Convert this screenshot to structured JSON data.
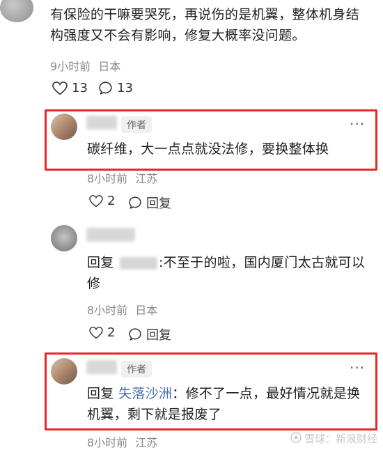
{
  "top_comment": {
    "text": "有保险的干嘛要哭死，再说伤的是机翼，整体机身结构强度又不会有影响，修复大概率没问题。",
    "time": "9小时前",
    "location": "日本",
    "likes": "13",
    "replies": "13"
  },
  "reply1": {
    "badge": "作者",
    "more": "···",
    "text": "碳纤维，大一点点就没法修，要换整体换",
    "time": "8小时前",
    "location": "江苏",
    "likes": "2",
    "reply_label": "回复"
  },
  "reply2": {
    "name_visible": "ㄓ",
    "prefix": "回复",
    "rest": ":不至于的啦，国内厦门太古就可以修",
    "time": "8小时前",
    "location": "日本",
    "likes": "2",
    "reply_label": "回复"
  },
  "reply3": {
    "badge": "作者",
    "more": "···",
    "prefix": "回复",
    "mention": "失落沙洲",
    "rest": "：修不了一点，最好情况就是换机翼，剩下就是报废了",
    "time": "8小时前",
    "location": "江苏"
  },
  "watermark": {
    "text": "雪球：新浪财经"
  },
  "colors": {
    "highlight": "#e8262a",
    "mention": "#4a72b0",
    "meta": "#8a8a8a"
  }
}
